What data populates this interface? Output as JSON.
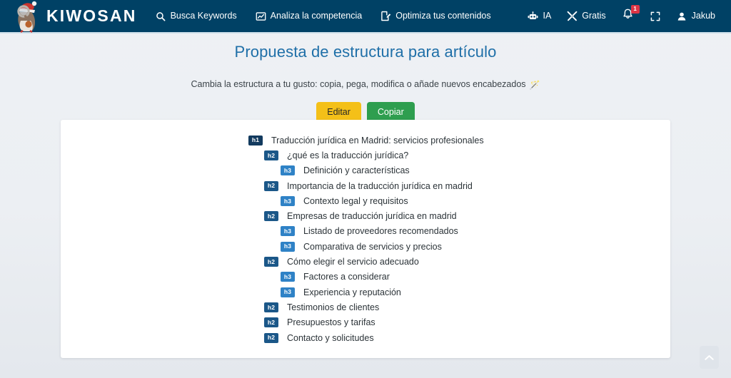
{
  "navbar": {
    "brand": {
      "name": "KIWOSAN",
      "mascot_icon": "kiwi-mascot-logo"
    },
    "main_items": [
      {
        "label": "Busca Keywords",
        "icon": "search-icon"
      },
      {
        "label": "Analiza la competencia",
        "icon": "chart-icon"
      },
      {
        "label": "Optimiza tus contenidos",
        "icon": "edit-document-icon"
      }
    ],
    "right_items": [
      {
        "label": "IA",
        "icon": "robot-icon"
      },
      {
        "label": "Gratis",
        "icon": "tools-icon"
      }
    ],
    "notifications": {
      "icon": "bell-icon",
      "count": "1"
    },
    "fullscreen": {
      "icon": "fullscreen-icon"
    },
    "user": {
      "label": "Jakub",
      "icon": "user-icon"
    },
    "background_color": "#004165",
    "border_color": "#cfe0ea"
  },
  "hero": {
    "title": "Propuesta de estructura para artículo",
    "subtitle": "Cambia la estructura a tu gusto: copia, pega, modifica o añade nuevos encabezados",
    "subtitle_emoji": "🪄",
    "title_color": "#1f6fa8"
  },
  "actions": {
    "edit_label": "Editar",
    "copy_label": "Copiar",
    "edit_color": "#f4c018",
    "copy_color": "#2e9e4f"
  },
  "outline": {
    "level_colors": {
      "h1": "#123a5e",
      "h2": "#1b5788",
      "h3": "#2f82c6"
    },
    "items": [
      {
        "level": "h1",
        "text": "Traducción jurídica en Madrid: servicios profesionales"
      },
      {
        "level": "h2",
        "text": "¿qué es la traducción jurídica?"
      },
      {
        "level": "h3",
        "text": "Definición y características"
      },
      {
        "level": "h2",
        "text": "Importancia de la traducción jurídica en madrid"
      },
      {
        "level": "h3",
        "text": "Contexto legal y requisitos"
      },
      {
        "level": "h2",
        "text": "Empresas de traducción jurídica en madrid"
      },
      {
        "level": "h3",
        "text": "Listado de proveedores recomendados"
      },
      {
        "level": "h3",
        "text": "Comparativa de servicios y precios"
      },
      {
        "level": "h2",
        "text": "Cómo elegir el servicio adecuado"
      },
      {
        "level": "h3",
        "text": "Factores a considerar"
      },
      {
        "level": "h3",
        "text": "Experiencia y reputación"
      },
      {
        "level": "h2",
        "text": "Testimonios de clientes"
      },
      {
        "level": "h2",
        "text": "Presupuestos y tarifas"
      },
      {
        "level": "h2",
        "text": "Contacto y solicitudes"
      }
    ]
  },
  "back_to_top": {
    "icon": "chevron-up-icon"
  }
}
